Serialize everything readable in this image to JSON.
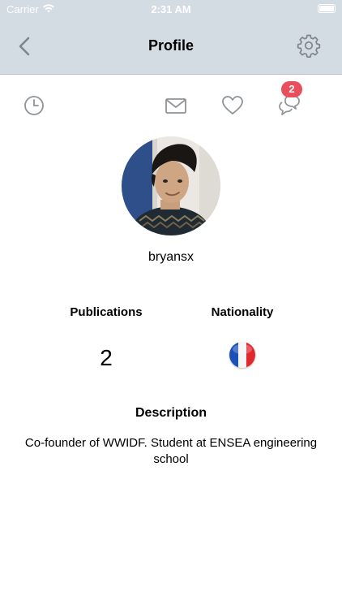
{
  "status_bar": {
    "carrier": "Carrier",
    "time": "2:31 AM"
  },
  "nav": {
    "title": "Profile",
    "back_icon": "chevron-left-icon",
    "settings_icon": "gear-icon"
  },
  "toolbar": {
    "history_icon": "clock-icon",
    "messages_icon": "envelope-icon",
    "favorites_icon": "heart-icon",
    "chat_icon": "chat-bubbles-icon",
    "chat_badge": "2"
  },
  "profile": {
    "username": "bryansx",
    "publications_label": "Publications",
    "publications_count": "2",
    "nationality_label": "Nationality",
    "nationality_flag": "france-flag-icon",
    "description_label": "Description",
    "description_text": "Co-founder of WWIDF. Student at ENSEA engineering school"
  },
  "colors": {
    "nav_background": "#d3dbe3",
    "icon_gray": "#8e9398",
    "badge_red": "#ea4d5c"
  }
}
